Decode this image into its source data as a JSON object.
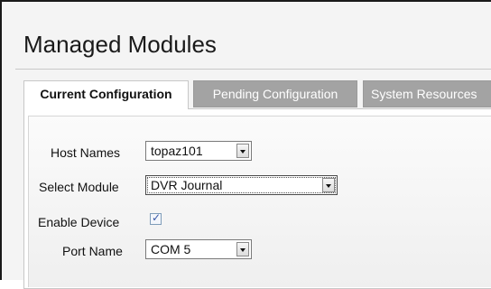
{
  "page": {
    "title": "Managed Modules"
  },
  "tabs": [
    {
      "label": "Current Configuration",
      "active": true
    },
    {
      "label": "Pending Configuration",
      "active": false
    },
    {
      "label": "System Resources",
      "active": false
    }
  ],
  "form": {
    "host_names": {
      "label": "Host Names",
      "value": "topaz101"
    },
    "select_module": {
      "label": "Select Module",
      "value": "DVR Journal"
    },
    "enable_device": {
      "label": "Enable Device",
      "checked": true,
      "check_glyph": "✓"
    },
    "port_name": {
      "label": "Port Name",
      "value": "COM 5"
    }
  },
  "colors": {
    "active_tab_bg": "#ffffff",
    "inactive_tab_bg": "#a3a3a3",
    "checkbox_check": "#3757a8"
  },
  "icons": {
    "dropdown": "chevron-down-icon",
    "checkbox": "checkmark-icon"
  }
}
